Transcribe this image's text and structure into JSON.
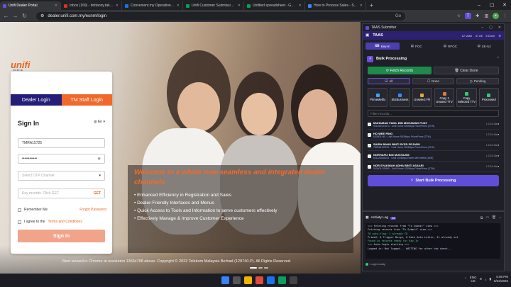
{
  "browser": {
    "tabs": [
      {
        "title": "Unifi Dealer Portal",
        "color": "#6c4fd8",
        "active": true
      },
      {
        "title": "Inbox (169) - brittanny.takagi@...",
        "color": "#d93025"
      },
      {
        "title": "Convenient.my Operations Por...",
        "color": "#1a73e8"
      },
      {
        "title": "Unifi Customer Submissions C...",
        "color": "#0f9d58"
      },
      {
        "title": "Untitled spreadsheet - Google...",
        "color": "#0f9d58"
      },
      {
        "title": "How to Process Sales - Step 1...",
        "color": "#4285f4"
      }
    ],
    "new_tab": "+",
    "url": "dealer.unifi.com.my/eunm/login",
    "zoom": "Go"
  },
  "login": {
    "logo": "unifi",
    "logo_sub": "MOBILE",
    "tab_dealer": "Dealer Login",
    "tab_staff": "TM Staff Login",
    "title": "Sign In",
    "language": "En",
    "username_value": "TMRA15725",
    "password_value": "••••••••••••",
    "otp_placeholder": "Select OTP Channel",
    "key_placeholder": "Key records. Click GET",
    "get_label": "GET",
    "remember_label": "Remember Me",
    "forgot_label": "Forgot Password",
    "agree_prefix": "I agree to the",
    "terms_label": "Terms and Conditions",
    "signin_button": "Sign In"
  },
  "welcome": {
    "title": "Welcome to a whole new seamless and integrated dealer channels",
    "bullets": [
      "Enhanced Efficiency in Registration and Sales",
      "Dealer-Friendly Interfaces and Menus",
      "Quick Access to Tools and Information to serve customers effectively",
      "Effectively Manage & Improve Customer Experience"
    ],
    "footer": "Best viewed in Chrome at resolution 1366x768 above. Copyright © 2023 Telekom Malaysia Berhad (128740-P). All Rights Reserved."
  },
  "panel": {
    "window_title": "TAAS Submitter",
    "app_name": "TAAS",
    "stats": [
      "12 Valid",
      "47 All",
      "8 Done"
    ],
    "nav": [
      "Key-In",
      "POC",
      "RPOC",
      "SE-NJ"
    ],
    "bulk_title": "Bulk Processing",
    "fetch_label": "Fetch Records",
    "clear_label": "Clear Done",
    "filters": [
      "All",
      "None",
      "Pending"
    ],
    "actions": [
      {
        "label": "PrimeMetfix",
        "color": "#3aa4ff"
      },
      {
        "label": "SkzBusiness",
        "color": "#3a8bff"
      },
      {
        "label": "Unselect FR",
        "color": "#e0a93a"
      },
      {
        "label": "Copy 1 Unused TTV",
        "color": "#e07b3a"
      },
      {
        "label": "Copy Selected TTV",
        "color": "#2ecc71"
      },
      {
        "label": "Processed",
        "color": "#2ecc71"
      }
    ],
    "search_placeholder": "Filter records...",
    "records": [
      {
        "name": "MUHAMAD FADIL BIN MOHAMAD PUAT",
        "sub": "901029014573 · Unifi Home 300Mbps PrimePrime (2TW)",
        "meta": "1.2.3 4.5a ■"
      },
      {
        "name": "HO WEE PING",
        "sub": "630809-M5 · Unifi Home 500Mbps PrimePrime (2TW)",
        "meta": "1.2.3 4.5a ■"
      },
      {
        "name": "SAIRA BANU BINTI SYED PEJARU",
        "sub": "750516105112 · Unifi Home 300Mbps PrimePrime (2TW)",
        "meta": "1.2.3 4.5a ■"
      },
      {
        "name": "NORHAFIZ BIN MUSTAZIM",
        "sub": "821128085201 · Unifi 100Mbps Home with Netflix (2kW)",
        "meta": "1.2.3 4.5a ■"
      },
      {
        "name": "NOR SYAKINAH ADHA BINTI ASAARI",
        "sub": "930405-02M05 · Unifi Home 100Mbps PrimePrime (2TW)",
        "meta": "1.2.3 4.5a ■"
      }
    ],
    "start_label": "Start Bulk Processing",
    "log_title": "Activity Log",
    "log_count": "48",
    "log_lines": [
      "=== Fetching records from \"To Submit\" view ===",
      "Fetching records from \"To Submit\" view ===",
      "T8 auto-flag: 1 already T8",
      "PrimeG: 0 Trigger Merge, 0 Rate Auth Letter, 41 already set",
      "Found 4x records ready for Key-In",
      "=== Auto-login starting ===",
      "Logged in: Not logged... WAITING for other tab check..."
    ],
    "footer_status": "Login ready"
  },
  "taskbar": {
    "lang": "ENG",
    "region": "US",
    "time": "5:06 PM",
    "date": "5/22/2026"
  }
}
